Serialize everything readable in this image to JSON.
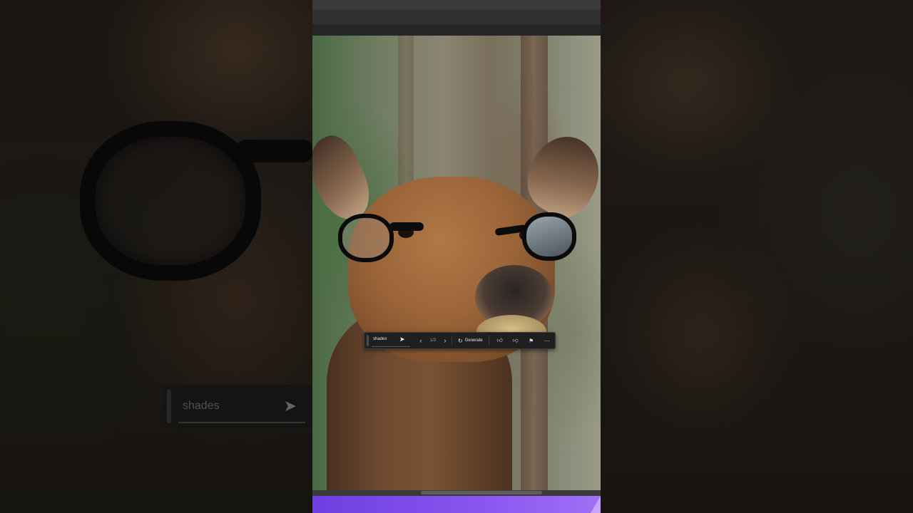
{
  "prompt": {
    "value": "shades"
  },
  "variations": {
    "counter": "1/3",
    "prev_icon": "chevron-left-icon",
    "next_icon": "chevron-right-icon"
  },
  "generate": {
    "label": "Generate",
    "icon": "refresh-icon"
  },
  "feedback": {
    "like_icon": "thumbs-up-icon",
    "dislike_icon": "thumbs-down-icon",
    "report_icon": "flag-icon",
    "more_icon": "more-icon"
  },
  "zoom_view": {
    "prompt_text": "shades"
  },
  "colors": {
    "toolbar_bg": "#1f1f1f",
    "accent_purple": "#7b4ae8",
    "panel_bg": "#2b2b2b"
  }
}
